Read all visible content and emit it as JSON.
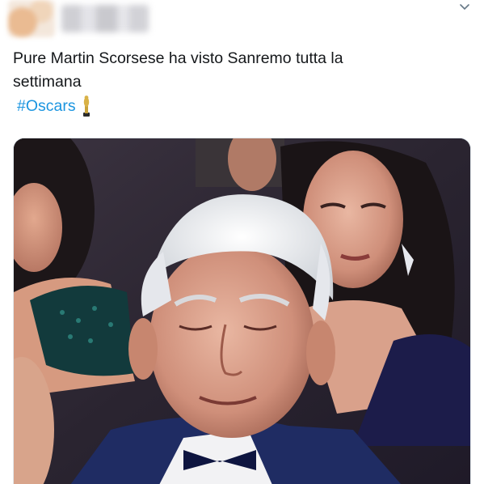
{
  "tweet": {
    "text_line1": "Pure Martin Scorsese ha visto Sanremo tutta la",
    "text_line2": "settimana",
    "hashtag": "#Oscars",
    "hashtag_emoji_icon": "trophy-icon",
    "menu_icon": "chevron-down-icon"
  },
  "media": {
    "kind": "photo",
    "subject": "man-with-white-hair-eyes-closed-in-audience"
  },
  "colors": {
    "hashtag": "#1b95e0",
    "text": "#14171a",
    "caret": "#657786",
    "border": "#e1e8ed"
  }
}
